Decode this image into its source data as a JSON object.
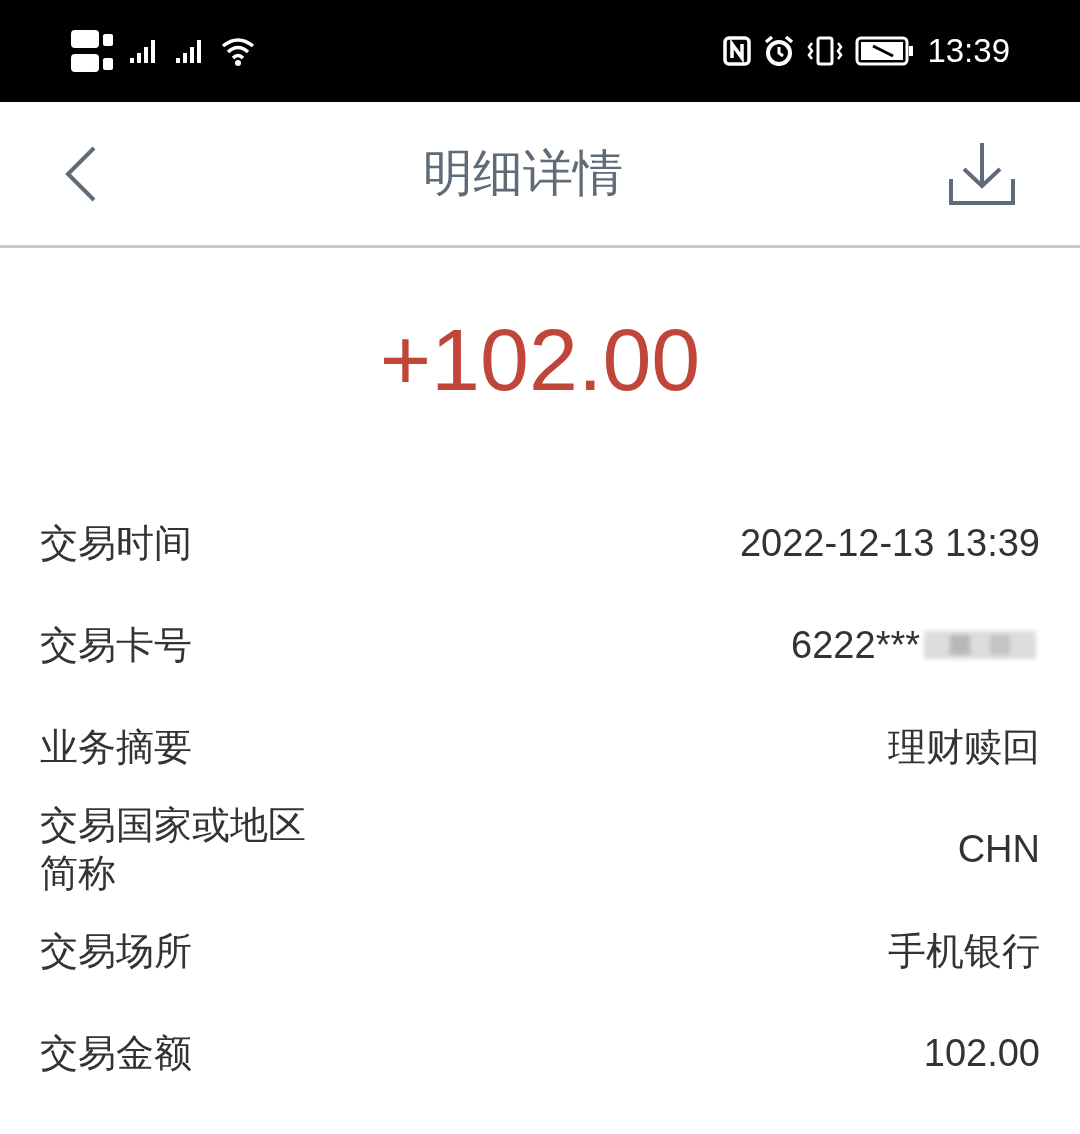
{
  "status_bar": {
    "time": "13:39"
  },
  "header": {
    "title": "明细详情"
  },
  "amount": "+102.00",
  "details": [
    {
      "label": "交易时间",
      "value": "2022-12-13 13:39"
    },
    {
      "label": "交易卡号",
      "value": "6222***",
      "redacted": true
    },
    {
      "label": "业务摘要",
      "value": "理财赎回"
    },
    {
      "label": "交易国家或地区简称",
      "value": "CHN"
    },
    {
      "label": "交易场所",
      "value": "手机银行"
    },
    {
      "label": "交易金额",
      "value": "102.00"
    }
  ]
}
